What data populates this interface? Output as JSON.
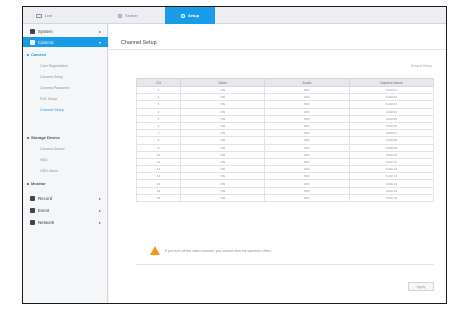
{
  "topbar": {
    "tabs": [
      {
        "label": "Live",
        "icon": "monitor-icon"
      },
      {
        "label": "Search",
        "icon": "search-icon"
      },
      {
        "label": "Setup",
        "icon": "gear-icon"
      }
    ]
  },
  "sidebar": {
    "sections": [
      {
        "label": "System",
        "icon": "system-icon"
      },
      {
        "label": "Camera",
        "icon": "camera-icon"
      }
    ],
    "groups": [
      {
        "label": "Camera",
        "items": [
          "Cam Registration",
          "Camera Setup",
          "Camera Password",
          "PoE Setup",
          "Channel Setup"
        ]
      },
      {
        "label": "Storage Device",
        "items": [
          "Camera Device",
          "HDD",
          "HDD Alarm"
        ]
      },
      {
        "label": "Monitor",
        "items": []
      }
    ],
    "bottom_sections": [
      {
        "label": "Record",
        "icon": "record-icon"
      },
      {
        "label": "Event",
        "icon": "event-icon"
      },
      {
        "label": "Network",
        "icon": "network-icon"
      }
    ]
  },
  "main": {
    "title": "Channel Setup",
    "link": "Default Setup",
    "columns": [
      "CH",
      "Video",
      "Audio",
      "Camera Name"
    ],
    "rows": [
      [
        "1",
        "ON",
        "OFF",
        "CAM 01"
      ],
      [
        "2",
        "ON",
        "OFF",
        "CAM 02"
      ],
      [
        "3",
        "ON",
        "OFF",
        "CAM 03"
      ],
      [
        "4",
        "ON",
        "OFF",
        "CAM 04"
      ],
      [
        "5",
        "ON",
        "OFF",
        "CAM 05"
      ],
      [
        "6",
        "ON",
        "OFF",
        "CAM 06"
      ],
      [
        "7",
        "ON",
        "OFF",
        "CAM 07"
      ],
      [
        "8",
        "ON",
        "OFF",
        "CAM 08"
      ],
      [
        "9",
        "ON",
        "OFF",
        "CAM 09"
      ],
      [
        "10",
        "ON",
        "OFF",
        "CAM 10"
      ],
      [
        "11",
        "ON",
        "OFF",
        "CAM 11"
      ],
      [
        "12",
        "ON",
        "OFF",
        "CAM 12"
      ],
      [
        "13",
        "ON",
        "OFF",
        "CAM 13"
      ],
      [
        "14",
        "ON",
        "OFF",
        "CAM 14"
      ],
      [
        "15",
        "ON",
        "OFF",
        "CAM 15"
      ],
      [
        "16",
        "ON",
        "OFF",
        "CAM 16"
      ]
    ],
    "warning": "If you turn off the video channel, you cannot view the camera's video.",
    "apply_label": "Apply"
  },
  "colors": {
    "accent": "#1a9be8",
    "warning": "#f19a1a"
  }
}
